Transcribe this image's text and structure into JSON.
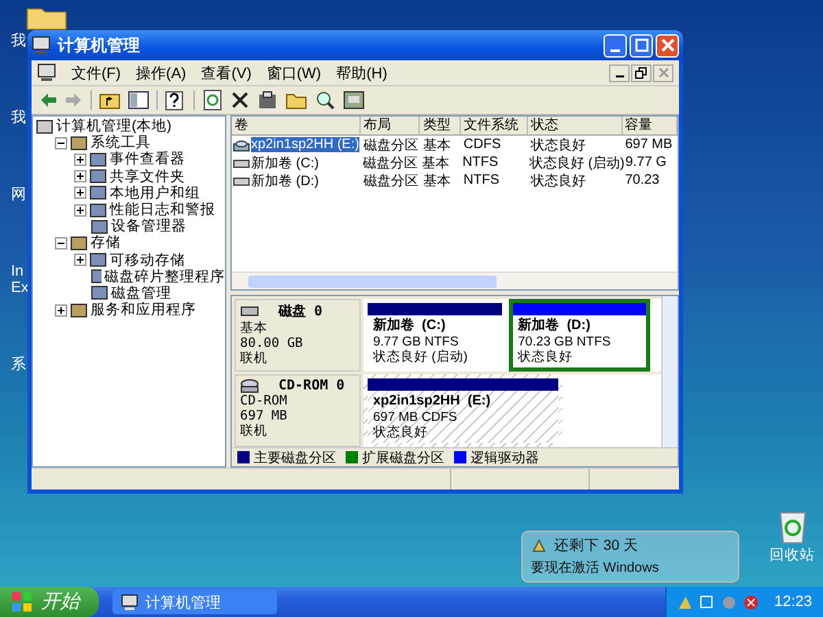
{
  "desktop": {
    "icon_labels": [
      "我",
      "我",
      "网",
      "In\nEx",
      "系"
    ],
    "recycle_bin": "回收站",
    "balloon": {
      "title": "还剩下 30 天",
      "text": "要现在激活 Windows"
    }
  },
  "window": {
    "title": "计算机管理",
    "menu": [
      "文件(F)",
      "操作(A)",
      "查看(V)",
      "窗口(W)",
      "帮助(H)"
    ],
    "tree": [
      {
        "label": "计算机管理(本地)",
        "children": [
          {
            "label": "系统工具",
            "expanded": true,
            "children": [
              {
                "label": "事件查看器",
                "expanded": false
              },
              {
                "label": "共享文件夹",
                "expanded": false
              },
              {
                "label": "本地用户和组",
                "expanded": false
              },
              {
                "label": "性能日志和警报",
                "expanded": false
              },
              {
                "label": "设备管理器"
              }
            ]
          },
          {
            "label": "存储",
            "expanded": true,
            "children": [
              {
                "label": "可移动存储",
                "expanded": false
              },
              {
                "label": "磁盘碎片整理程序"
              },
              {
                "label": "磁盘管理"
              }
            ]
          },
          {
            "label": "服务和应用程序",
            "expanded": false
          }
        ]
      }
    ],
    "volumes": {
      "columns": [
        "卷",
        "布局",
        "类型",
        "文件系统",
        "状态",
        "容量"
      ],
      "rows": [
        {
          "kind": "cdrom",
          "selected": true,
          "cells": [
            "xp2in1sp2HH (E:)",
            "磁盘分区",
            "基本",
            "CDFS",
            "状态良好",
            "697 MB"
          ]
        },
        {
          "kind": "disk",
          "selected": false,
          "cells": [
            "新加卷 (C:)",
            "磁盘分区",
            "基本",
            "NTFS",
            "状态良好 (启动)",
            "9.77 G"
          ]
        },
        {
          "kind": "disk",
          "selected": false,
          "cells": [
            "新加卷 (D:)",
            "磁盘分区",
            "基本",
            "NTFS",
            "状态良好",
            "70.23"
          ]
        }
      ]
    },
    "disks": [
      {
        "kind": "disk",
        "name": "磁盘 0",
        "type": "基本",
        "size": "80.00 GB",
        "status": "联机",
        "partitions": [
          {
            "kind": "primary",
            "selected": false,
            "name": "新加卷  (C:)",
            "info": "9.77 GB NTFS",
            "status": "状态良好 (启动)"
          },
          {
            "kind": "logical",
            "selected": true,
            "name": "新加卷  (D:)",
            "info": "70.23 GB NTFS",
            "status": "状态良好"
          }
        ]
      },
      {
        "kind": "cdrom",
        "name": "CD-ROM 0",
        "type": "CD-ROM",
        "size": "697 MB",
        "status": "联机",
        "partitions": [
          {
            "kind": "cdrom",
            "selected": false,
            "name": "xp2in1sp2HH  (E:)",
            "info": "697 MB CDFS",
            "status": "状态良好"
          }
        ]
      }
    ],
    "legend": [
      {
        "label": "主要磁盘分区",
        "color": "#000080"
      },
      {
        "label": "扩展磁盘分区",
        "color": "#008000"
      },
      {
        "label": "逻辑驱动器",
        "color": "#0000ff"
      }
    ]
  },
  "taskbar": {
    "start": "开始",
    "tasks": [
      {
        "label": "计算机管理",
        "selected": false
      }
    ],
    "clock": "12:23"
  }
}
